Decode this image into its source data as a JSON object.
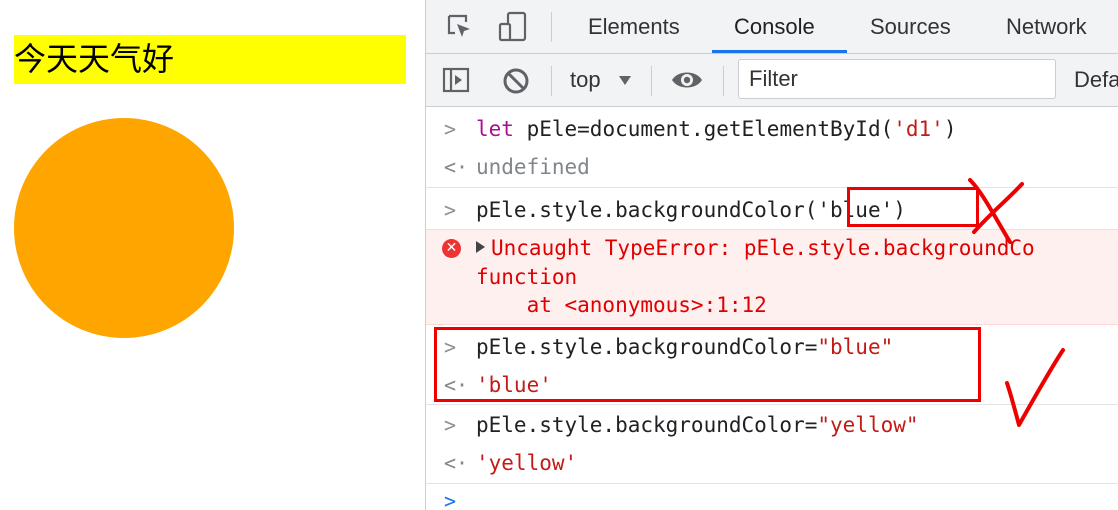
{
  "page": {
    "paragraph_text": "今天天气好",
    "paragraph_bg": "#ffff00",
    "circle_color": "#ffa500"
  },
  "devtools": {
    "tabs": [
      {
        "label": "Elements"
      },
      {
        "label": "Console",
        "active": true
      },
      {
        "label": "Sources"
      },
      {
        "label": "Network"
      }
    ],
    "toolbar": {
      "context": "top",
      "filter_placeholder": "Filter",
      "levels_label": "Defa"
    },
    "console": {
      "lines": {
        "l1_kw": "let",
        "l1_code": " pEle=document.getElementById(",
        "l1_str": "'d1'",
        "l1_close": ")",
        "l2_out": "undefined",
        "l3_code": "pEle.style.backgroundColor",
        "l3_args": "('blue')",
        "err_msg": "Uncaught TypeError: pEle.style.backgroundCo",
        "err_line2": "function",
        "err_line3": "    at <anonymous>:1:12",
        "l4_code": "pEle.style.backgroundColor=",
        "l4_str": "\"blue\"",
        "l5_out": "'blue'",
        "l6_code": "pEle.style.backgroundColor=",
        "l6_str": "\"yellow\"",
        "l7_out": "'yellow'"
      }
    }
  },
  "colors": {
    "accent": "#1a73e8",
    "annotation_red": "#e00000",
    "error_bg": "#fff0f0",
    "keyword": "#aa0d91",
    "string": "#c41a16"
  },
  "icons": [
    "inspect-element-icon",
    "device-toolbar-icon",
    "sidebar-toggle-icon",
    "clear-console-icon",
    "dropdown-arrow-icon",
    "live-expression-eye-icon",
    "error-icon",
    "expand-triangle-icon",
    "prompt-chevron-icon",
    "result-arrow-icon"
  ]
}
